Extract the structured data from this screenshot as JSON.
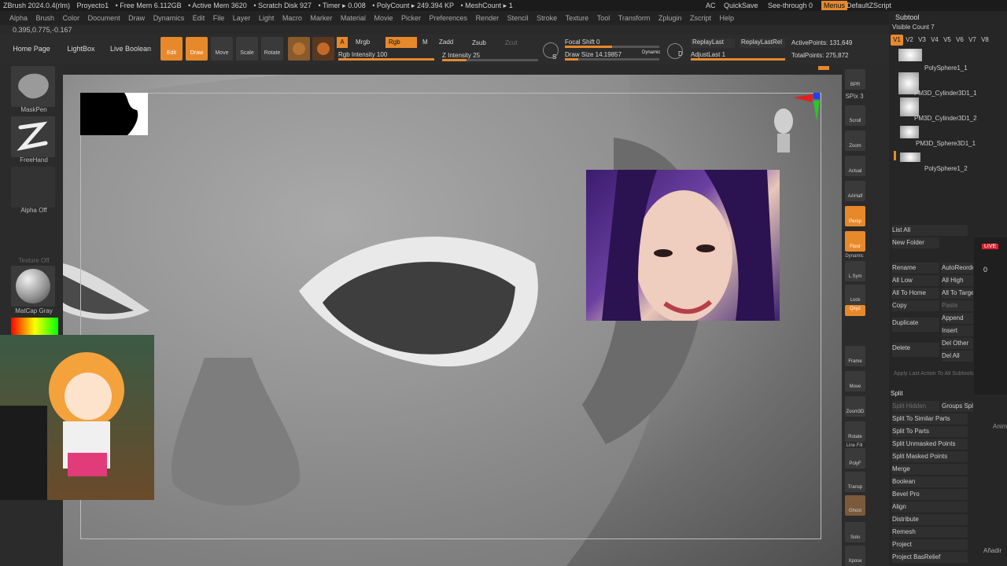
{
  "app": {
    "status": [
      "ZBrush 2024.0.4(rlm)",
      "Proyecto1",
      "• Free Mem 6.112GB",
      "• Active Mem 3620",
      "• Scratch Disk 927",
      "• Timer ▸ 0.008",
      "• PolyCount ▸ 249.394 KP",
      "• MeshCount ▸ 1"
    ],
    "right": {
      "ac": "AC",
      "quicksave": "QuickSave",
      "seethrough": "See-through",
      "seethrough_val": "0",
      "menus": "Menus",
      "script": "DefaultZScript"
    }
  },
  "menubar": [
    "Alpha",
    "Brush",
    "Color",
    "Document",
    "Draw",
    "Dynamics",
    "Edit",
    "File",
    "Layer",
    "Light",
    "Macro",
    "Marker",
    "Material",
    "Movie",
    "Picker",
    "Preferences",
    "Render",
    "Stencil",
    "Stroke",
    "Texture",
    "Tool",
    "Transform",
    "Zplugin",
    "Zscript",
    "Help"
  ],
  "coord": "0.395,0.775,-0.167",
  "toolbar": {
    "home": "Home Page",
    "lightbox": "LightBox",
    "liveboolean": "Live Boolean",
    "edit": "Edit",
    "draw": "Draw",
    "move": "Move",
    "scale": "Scale",
    "rotate": "Rotate",
    "a": "A",
    "mrgb": "Mrgb",
    "rgb": "Rgb",
    "m": "M",
    "zadd": "Zadd",
    "zsub": "Zsub",
    "zcut": "Zcut",
    "rgb_intensity": "Rgb Intensity 100",
    "z_intensity": "Z Intensity 25",
    "focal_shift": "Focal Shift 0",
    "draw_size": "Draw Size 14.19857",
    "dynamic": "Dynamic",
    "s": "S",
    "d": "D",
    "replaylast": "ReplayLast",
    "replaylastrel": "ReplayLastRel",
    "adjustlast": "AdjustLast 1",
    "activepoints": "ActivePoints: 131,649",
    "totalpoints": "TotalPoints: 275,872",
    "rgb_intensity_value": 1.0,
    "z_intensity_value": 0.25,
    "draw_size_value": 0.14
  },
  "leftpanel": {
    "maskpen": "MaskPen",
    "freehand": "FreeHand",
    "alphaoff": "Alpha Off",
    "textureoff": "Texture Off",
    "matcap": "MatCap Gray"
  },
  "rightdock": [
    "BPR",
    "SPix 3",
    "Scroll",
    "Zoom",
    "Actual",
    "AAHalf",
    "Persp",
    "Floor",
    "Dynamic",
    "L.Sym",
    "Lock",
    "Qxyz",
    "Frame",
    "Move",
    "Zoom3D",
    "Rotate",
    "Line Fill",
    "PolyF",
    "Transp",
    "Ghost",
    "Solo",
    "Dynamic",
    "Xpose"
  ],
  "subtool": {
    "title": "Subtool",
    "visible_count": "Visible Count 7",
    "tabs": [
      "V1",
      "V2",
      "V3",
      "V4",
      "V5",
      "V6",
      "V7",
      "V8"
    ],
    "items": [
      "PolySphere1_1",
      "PM3D_Cylinder3D1_1",
      "PM3D_Cylinder3D1_2",
      "PM3D_Sphere3D1_1",
      "PolySphere1_2"
    ],
    "listall": "List All",
    "newfolder": "New Folder",
    "rename": "Rename",
    "autoreorder": "AutoReorder",
    "alllow": "All Low",
    "allhigh": "All High",
    "alltohome": "All To Home",
    "alltotarget": "All To Target",
    "copy": "Copy",
    "paste": "Paste",
    "duplicate": "Duplicate",
    "append": "Append",
    "insert": "Insert",
    "delete": "Delete",
    "delother": "Del Other",
    "delall": "Del All",
    "applylast": "Apply Last Action To All Subtools",
    "split": "Split",
    "splithidden": "Split Hidden",
    "groupssplit": "Groups Split",
    "splitsimilar": "Split To Similar Parts",
    "splitparts": "Split To Parts",
    "splitunmasked": "Split Unmasked Points",
    "splitmasked": "Split Masked Points",
    "merge": "Merge",
    "boolean": "Boolean",
    "bevelpro": "Bevel Pro",
    "align": "Align",
    "distribute": "Distribute",
    "remesh": "Remesh",
    "project": "Project",
    "projectbas": "Project BasRelief"
  },
  "overlay": {
    "live": "LIVE",
    "viewers": "0",
    "anim": "Anim",
    "anadir": "Añadir"
  }
}
